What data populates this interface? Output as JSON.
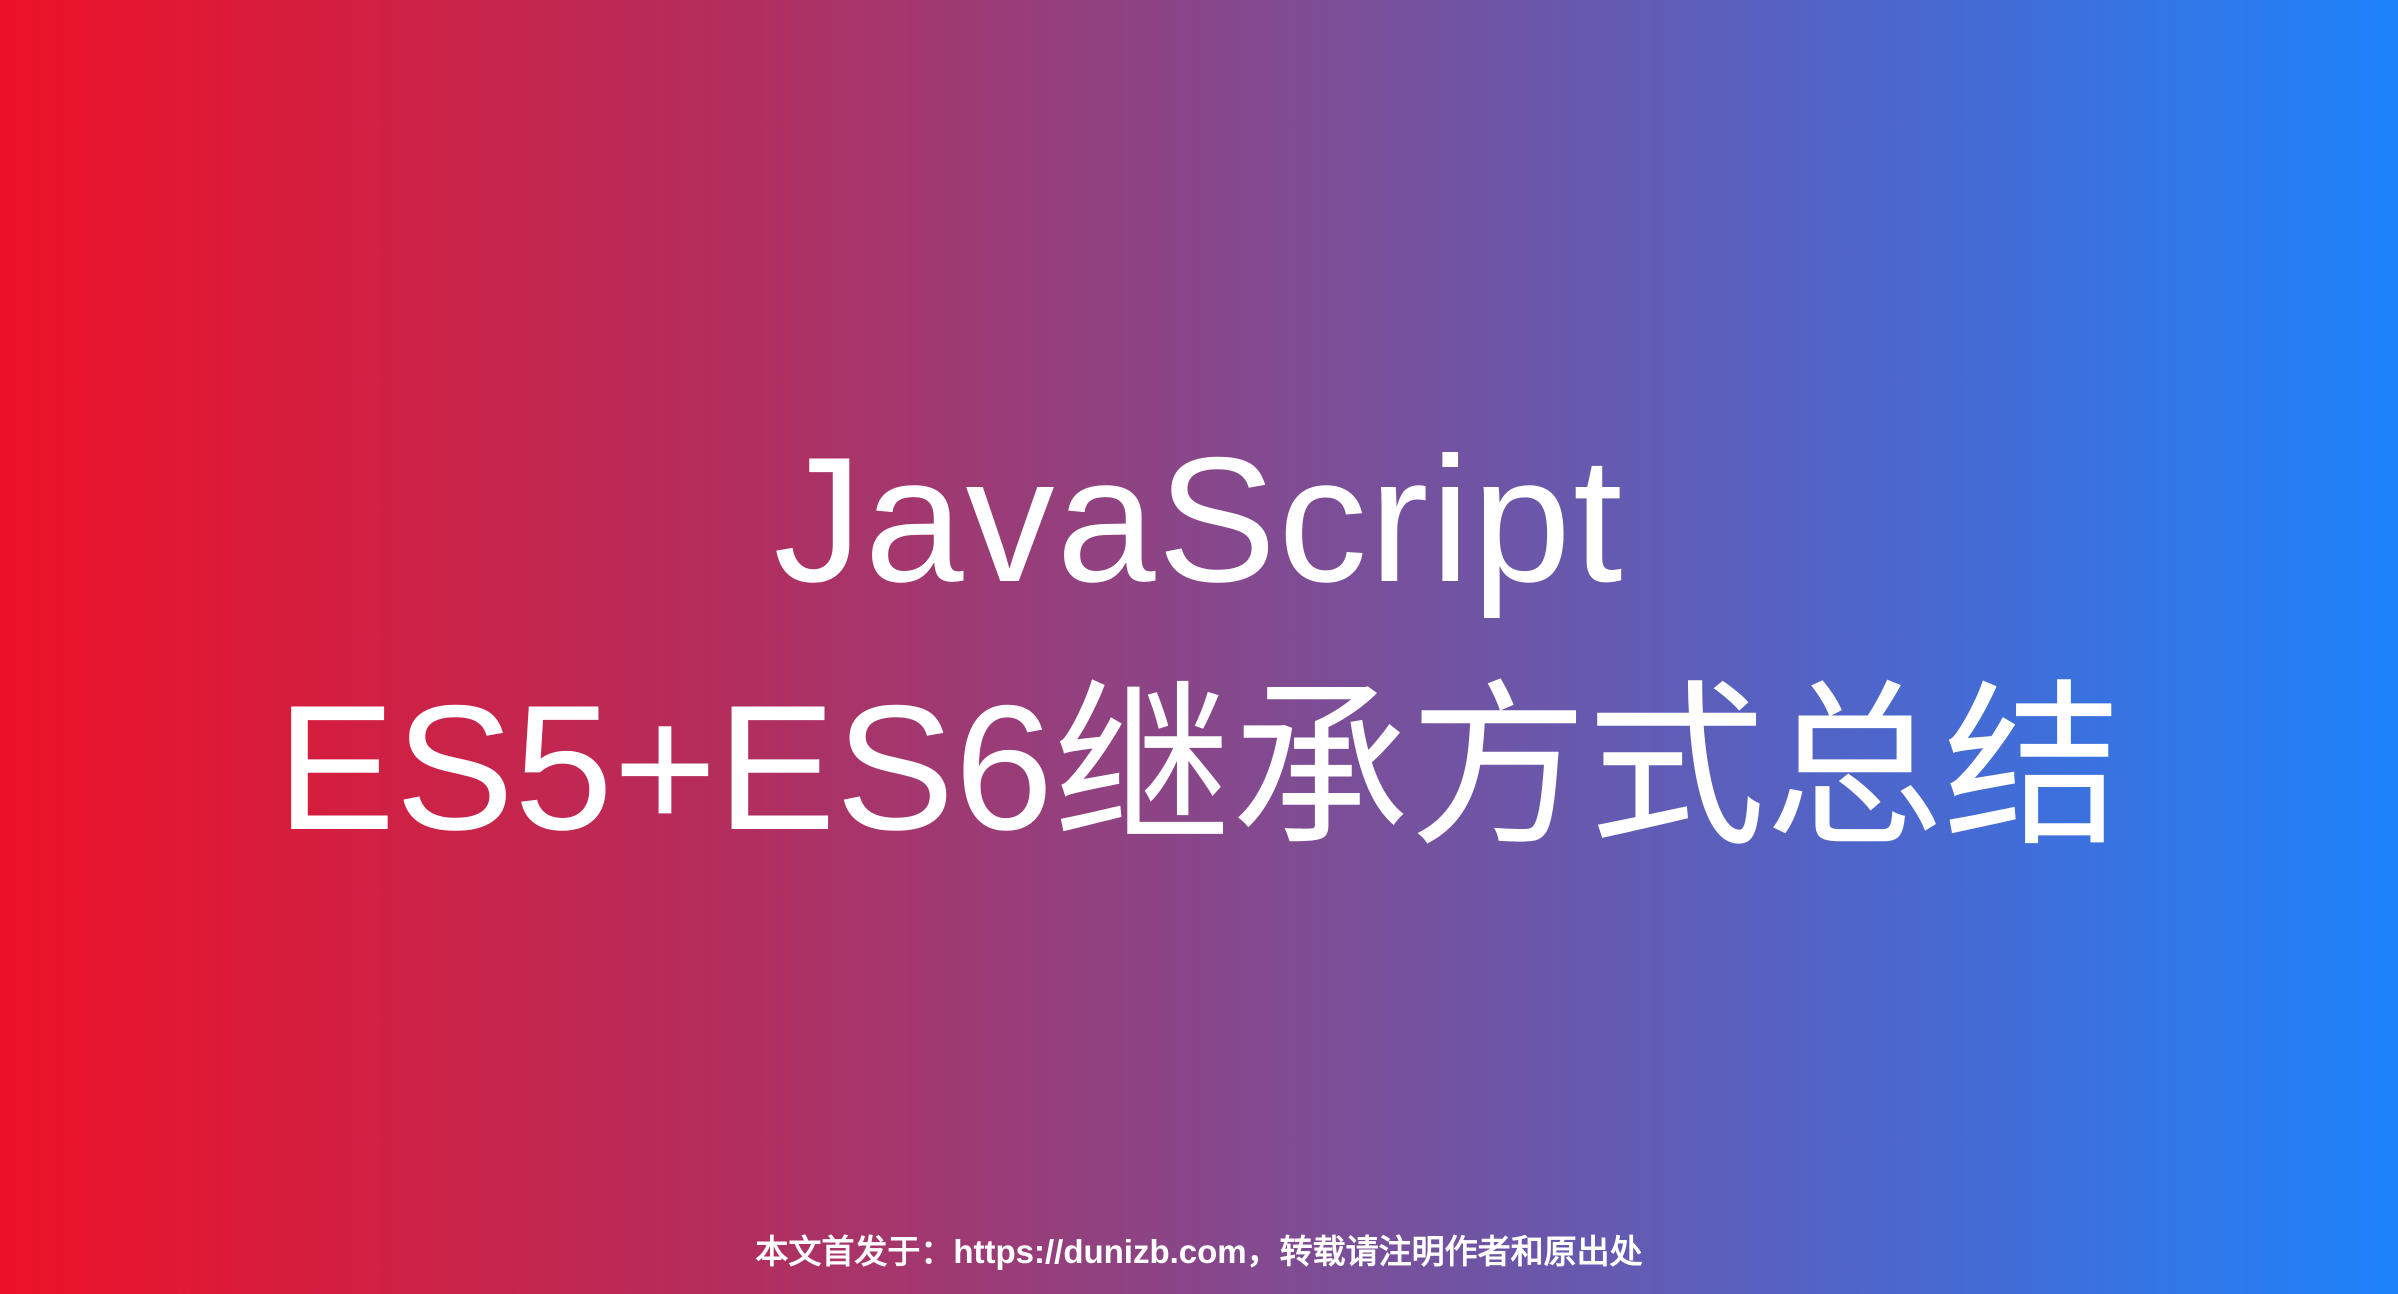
{
  "title": {
    "line1": "JavaScript",
    "line2": "ES5+ES6继承方式总结"
  },
  "footer": "本文首发于：https://dunizb.com，转载请注明作者和原出处",
  "colors": {
    "gradient_start": "#ee1228",
    "gradient_end": "#1d83fb",
    "text": "#ffffff"
  }
}
